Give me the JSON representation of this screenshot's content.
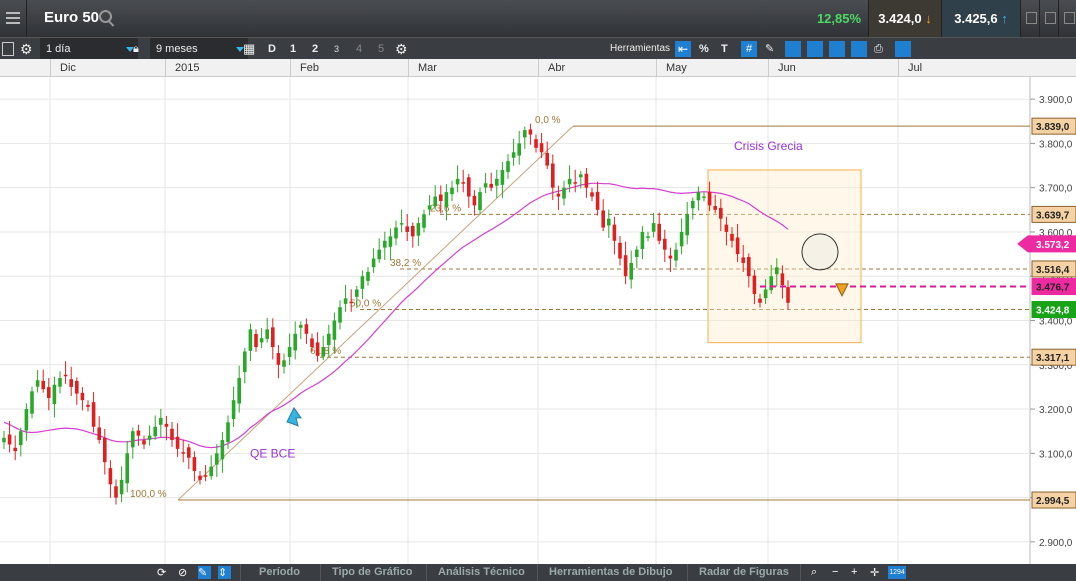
{
  "header": {
    "title": "Euro 50",
    "change_pct": "12,85%",
    "sell_price": "3.424,0",
    "buy_price": "3.425,6"
  },
  "toolbar": {
    "interval": "1 día",
    "period": "9 meses",
    "range_buttons": [
      "D",
      "1",
      "2",
      "3",
      "4",
      "5"
    ],
    "tools_label": "Herramientas"
  },
  "bottom": {
    "items": [
      "Período",
      "Tipo de Gráfico",
      "Análisis Técnico",
      "Herramientas de Dibujo",
      "Radar de Figuras"
    ],
    "zoom_badge": "1294"
  },
  "chart_data": {
    "type": "candlestick",
    "x_axis": {
      "ticks": [
        "Dic",
        "2015",
        "Feb",
        "Mar",
        "Abr",
        "May",
        "Jun",
        "Jul"
      ]
    },
    "y_axis": {
      "range": [
        2850,
        3950
      ],
      "tick_labels": [
        "3.900,0",
        "3.800,0",
        "3.700,0",
        "3.600,0",
        "3.500,0",
        "3.400,0",
        "3.300,0",
        "3.200,0",
        "3.100,0",
        "3.000,0",
        "2.900,0"
      ],
      "tick_values": [
        3900,
        3800,
        3700,
        3600,
        3500,
        3400,
        3300,
        3200,
        3100,
        3000,
        2900
      ]
    },
    "grid": true,
    "colors": {
      "up": "#2aa82a",
      "down": "#e02020",
      "ma": "#d43fd4",
      "fib": "#a0783a",
      "annotation": "#9b30d9",
      "box": "#f0b050",
      "current": "#19a319",
      "target": "#d81b9b"
    },
    "series": [
      {
        "name": "",
        "values": [
          3135,
          3120,
          3105,
          3150,
          3200,
          3240,
          3265,
          3245,
          3225,
          3255,
          3270,
          3275,
          3250,
          3235,
          3220,
          3205,
          3160,
          3130,
          3080,
          3030,
          3000,
          3040,
          3100,
          3150,
          3140,
          3120,
          3140,
          3160,
          3180,
          3160,
          3130,
          3110,
          3100,
          3090,
          3060,
          3040,
          3050,
          3070,
          3100,
          3130,
          3170,
          3220,
          3270,
          3330,
          3380,
          3340,
          3360,
          3380,
          3340,
          3300,
          3310,
          3340,
          3370,
          3390,
          3370,
          3340,
          3320,
          3340,
          3370,
          3400,
          3430,
          3450,
          3440,
          3470,
          3500,
          3510,
          3540,
          3560,
          3580,
          3590,
          3610,
          3620,
          3600,
          3590,
          3620,
          3640,
          3660,
          3680,
          3670,
          3690,
          3700,
          3720,
          3710,
          3680,
          3660,
          3690,
          3710,
          3700,
          3720,
          3740,
          3760,
          3780,
          3800,
          3830,
          3820,
          3790,
          3780,
          3750,
          3700,
          3680,
          3700,
          3720,
          3710,
          3730,
          3700,
          3680,
          3650,
          3610,
          3630,
          3580,
          3540,
          3500,
          3530,
          3560,
          3600,
          3590,
          3620,
          3580,
          3560,
          3540,
          3560,
          3600,
          3640,
          3670,
          3690,
          3680,
          3660,
          3650,
          3630,
          3600,
          3580,
          3550,
          3530,
          3500,
          3460,
          3440,
          3470,
          3500,
          3520,
          3480,
          3440
        ]
      },
      {
        "name": "",
        "values": [
          3170,
          3165,
          3158,
          3152,
          3148,
          3147,
          3148,
          3150,
          3152,
          3154,
          3156,
          3157,
          3156,
          3155,
          3152,
          3148,
          3144,
          3140,
          3135,
          3130,
          3127,
          3126,
          3126,
          3128,
          3130,
          3131,
          3133,
          3134,
          3136,
          3136,
          3135,
          3133,
          3130,
          3127,
          3122,
          3117,
          3114,
          3113,
          3114,
          3117,
          3122,
          3128,
          3136,
          3146,
          3158,
          3167,
          3177,
          3188,
          3196,
          3202,
          3209,
          3217,
          3226,
          3236,
          3244,
          3251,
          3258,
          3266,
          3275,
          3285,
          3296,
          3308,
          3319,
          3331,
          3344,
          3357,
          3371,
          3385,
          3399,
          3413,
          3427,
          3441,
          3453,
          3464,
          3476,
          3488,
          3500,
          3512,
          3523,
          3534,
          3545,
          3556,
          3566,
          3574,
          3582,
          3590,
          3598,
          3605,
          3613,
          3621,
          3629,
          3638,
          3647,
          3657,
          3666,
          3673,
          3680,
          3685,
          3689,
          3692,
          3695,
          3699,
          3702,
          3706,
          3708,
          3710,
          3710,
          3709,
          3709,
          3707,
          3704,
          3701,
          3699,
          3698,
          3699,
          3698,
          3698,
          3696,
          3693,
          3690,
          3688,
          3687,
          3688,
          3689,
          3690,
          3691,
          3690,
          3689,
          3687,
          3684,
          3680,
          3675,
          3670,
          3664,
          3655,
          3646,
          3638,
          3631,
          3624,
          3616,
          3606
        ]
      }
    ],
    "price_labels": [
      {
        "label": "3.839,0",
        "value": 3839
      },
      {
        "label": "3.639,7",
        "value": 3639.7
      },
      {
        "label": "3.573,2",
        "value": 3573.2
      },
      {
        "label": "3.516,4",
        "value": 3516.4
      },
      {
        "label": "3.476,7",
        "value": 3476.7
      },
      {
        "label": "3.424,8",
        "value": 3424.8
      },
      {
        "label": "3.317,1",
        "value": 3317.1
      },
      {
        "label": "2.994,5",
        "value": 2994.5
      }
    ],
    "fibonacci": [
      {
        "label": "0,0 %",
        "value": 3839
      },
      {
        "label": "23,6 %",
        "value": 3639.7
      },
      {
        "label": "38,2 %",
        "value": 3516.4
      },
      {
        "label": "50,0 %",
        "value": 3424.8
      },
      {
        "label": "61,8 %",
        "value": 3317.1
      },
      {
        "label": "100,0 %",
        "value": 2994.5
      }
    ],
    "annotations": [
      "QE BCE",
      "Crisis Grecia"
    ]
  }
}
